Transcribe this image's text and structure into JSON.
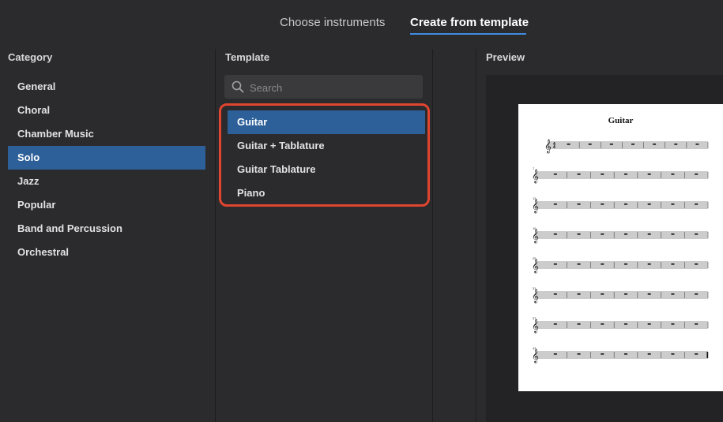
{
  "tabs": {
    "choose": "Choose instruments",
    "create": "Create from template"
  },
  "category": {
    "header": "Category",
    "items": [
      "General",
      "Choral",
      "Chamber Music",
      "Solo",
      "Jazz",
      "Popular",
      "Band and Percussion",
      "Orchestral"
    ],
    "selected": "Solo"
  },
  "template": {
    "header": "Template",
    "search_placeholder": "Search",
    "items": [
      "Guitar",
      "Guitar + Tablature",
      "Guitar Tablature",
      "Piano"
    ],
    "selected": "Guitar"
  },
  "preview": {
    "header": "Preview",
    "score_title": "Guitar",
    "measure_numbers": [
      "7",
      "13",
      "19",
      "25",
      "31",
      "37",
      "43"
    ]
  },
  "colors": {
    "selection": "#2d5f99",
    "highlight_border": "#e0452f",
    "tab_underline": "#3f8ce0"
  }
}
